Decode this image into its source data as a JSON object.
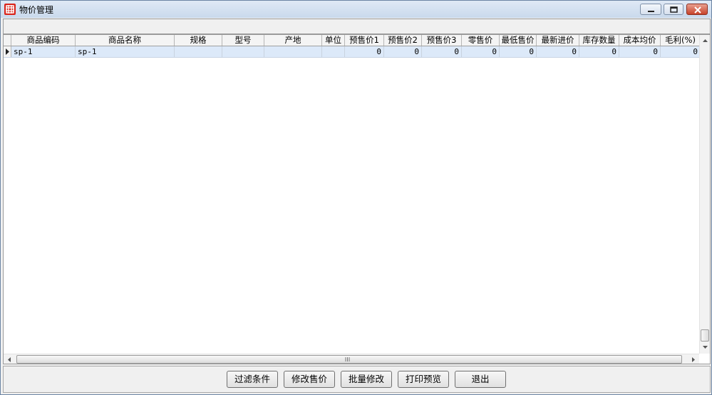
{
  "window": {
    "title": "物价管理"
  },
  "grid": {
    "columns": [
      "商品编码",
      "商品名称",
      "规格",
      "型号",
      "产地",
      "单位",
      "预售价1",
      "预售价2",
      "预售价3",
      "零售价",
      "最低售价",
      "最新进价",
      "库存数量",
      "成本均价",
      "毛利(%)"
    ],
    "rows": [
      [
        "sp-1",
        "sp-1",
        "",
        "",
        "",
        "",
        "0",
        "0",
        "0",
        "0",
        "0",
        "0",
        "0",
        "0",
        "0"
      ]
    ]
  },
  "buttons": {
    "filter": "过滤条件",
    "edit_price": "修改售价",
    "batch_edit": "批量修改",
    "print_preview": "打印预览",
    "exit": "退出"
  }
}
